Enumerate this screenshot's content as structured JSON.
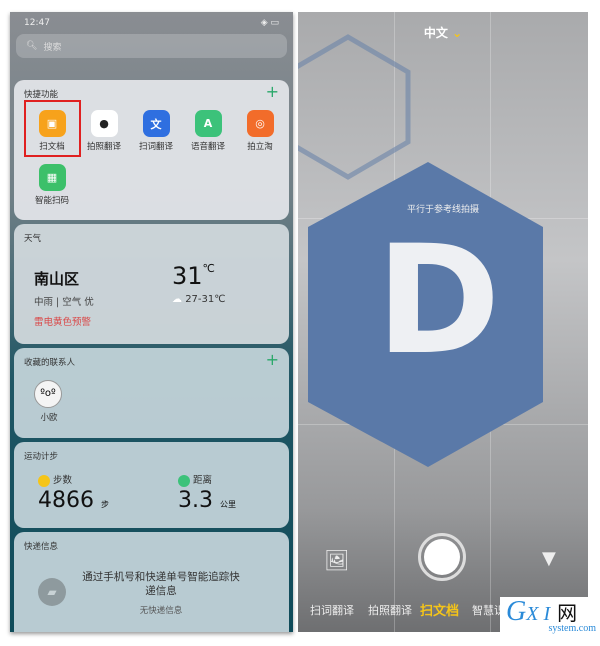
{
  "status": {
    "time": "12:47"
  },
  "search": {
    "placeholder": "搜索"
  },
  "quick": {
    "title": "快捷功能",
    "items": [
      {
        "label": "扫文档",
        "color": "#f7a21b"
      },
      {
        "label": "拍照翻译",
        "color": "#ffffff"
      },
      {
        "label": "扫词翻译",
        "color": "#2f6fe0"
      },
      {
        "label": "语音翻译",
        "color": "#3cc27a"
      },
      {
        "label": "拍立淘",
        "color": "#f26c2a"
      },
      {
        "label": "智能扫码",
        "color": "#3cc06a"
      }
    ]
  },
  "weather": {
    "title": "天气",
    "location": "南山区",
    "condition": "中雨 | 空气 优",
    "warning": "雷电黄色预警",
    "temp": "31",
    "unit": "℃",
    "range": "27-31℃"
  },
  "contacts": {
    "title": "收藏的联系人",
    "items": [
      {
        "name": "小欧"
      }
    ]
  },
  "steps": {
    "title": "运动计步",
    "steps_label": "步数",
    "steps_value": "4866",
    "steps_unit": "步",
    "distance_label": "距离",
    "distance_value": "3.3",
    "distance_unit": "公里"
  },
  "express": {
    "title": "快递信息",
    "message": "通过手机号和快递单号智能追踪快递信息",
    "empty": "无快递信息"
  },
  "camera": {
    "language": "中文",
    "hint": "平行于参考线拍摄",
    "letter": "D",
    "modes": [
      "扫词翻译",
      "拍照翻译",
      "扫文档",
      "智慧识"
    ],
    "active_mode": "扫文档",
    "accent": "#f5c518"
  },
  "watermark": {
    "text": "GXI网",
    "sub": "system.com"
  }
}
